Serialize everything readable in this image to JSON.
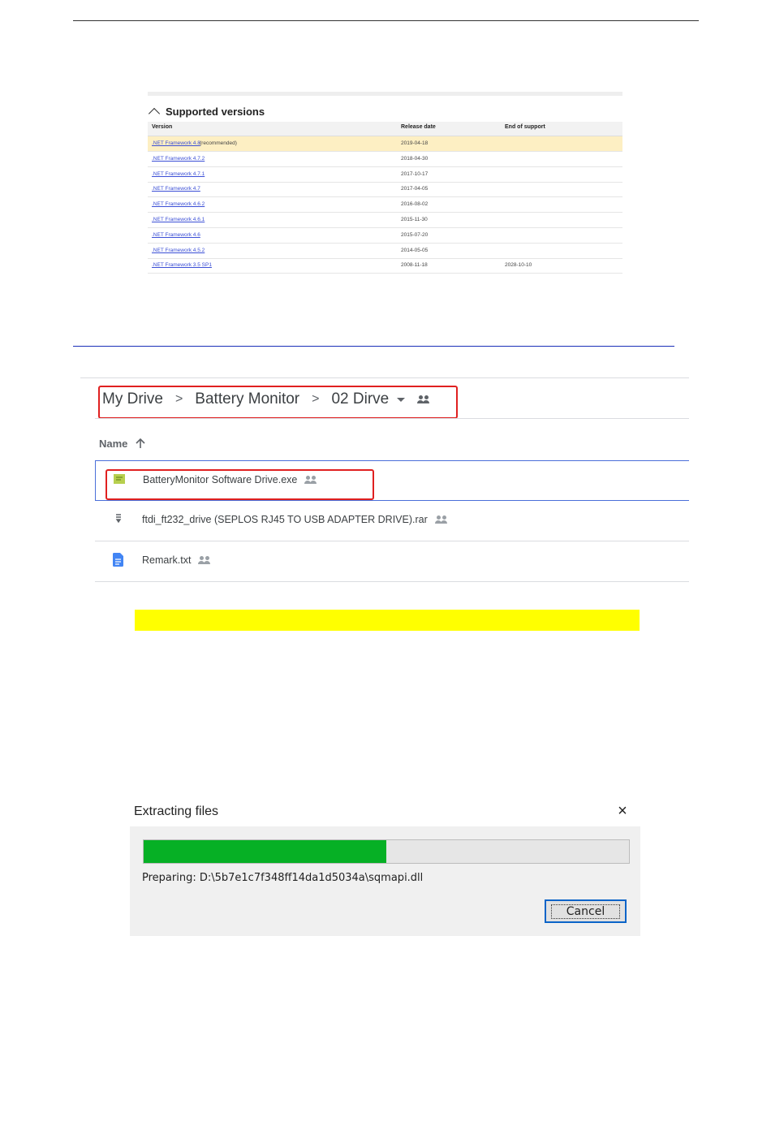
{
  "supported_versions": {
    "heading": "Supported versions",
    "columns": [
      "Version",
      "Release date",
      "End of support"
    ],
    "rows": [
      {
        "version": ".NET Framework 4.8",
        "note": "(recommended)",
        "release": "2019-04-18",
        "end": "",
        "highlight": true
      },
      {
        "version": ".NET Framework 4.7.2",
        "note": "",
        "release": "2018-04-30",
        "end": ""
      },
      {
        "version": ".NET Framework 4.7.1",
        "note": "",
        "release": "2017-10-17",
        "end": ""
      },
      {
        "version": ".NET Framework 4.7",
        "note": "",
        "release": "2017-04-05",
        "end": ""
      },
      {
        "version": ".NET Framework 4.6.2",
        "note": "",
        "release": "2016-08-02",
        "end": ""
      },
      {
        "version": ".NET Framework 4.6.1",
        "note": "",
        "release": "2015-11-30",
        "end": ""
      },
      {
        "version": ".NET Framework 4.6",
        "note": "",
        "release": "2015-07-20",
        "end": ""
      },
      {
        "version": ".NET Framework 4.5.2",
        "note": "",
        "release": "2014-05-05",
        "end": ""
      },
      {
        "version": ".NET Framework 3.5 SP1",
        "note": "",
        "release": "2008-11-18",
        "end": "2028-10-10"
      }
    ]
  },
  "drive": {
    "breadcrumb": [
      "My Drive",
      "Battery Monitor",
      "02 Dirve"
    ],
    "breadcrumb_separator": ">",
    "name_header": "Name",
    "sort_icon": "arrow-up-icon",
    "files": [
      {
        "name": "BatteryMonitor Software Drive.exe",
        "icon": "exe-file-icon",
        "shared": true
      },
      {
        "name": "ftdi_ft232_drive (SEPLOS RJ45 TO USB ADAPTER DRIVE).rar",
        "icon": "archive-file-icon",
        "shared": true
      },
      {
        "name": "Remark.txt",
        "icon": "document-file-icon",
        "shared": true
      }
    ]
  },
  "extract_dialog": {
    "title": "Extracting files",
    "close_label": "×",
    "progress": 0.5,
    "status": "Preparing: D:\\5b7e1c7f348ff14da1d5034a\\sqmapi.dll",
    "cancel_label": "Cancel"
  },
  "colors": {
    "highlight_row": "#fdefc3",
    "red_box": "#e02020",
    "yellow_bar": "#ffff00",
    "progress": "#06b025",
    "link": "#3b4fd6"
  }
}
